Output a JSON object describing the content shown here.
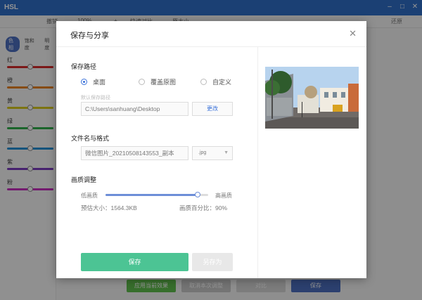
{
  "app": {
    "title": "HSL",
    "toolbar": [
      "撤销",
      "100%",
      "+",
      "快速对比",
      "原大小"
    ],
    "restore": "还原",
    "tabs": [
      "色相",
      "饱和度",
      "明度"
    ],
    "channels": [
      {
        "label": "红",
        "color": "#d62a2a"
      },
      {
        "label": "橙",
        "color": "#e8821c"
      },
      {
        "label": "黄",
        "color": "#d8c81c"
      },
      {
        "label": "绿",
        "color": "#2fae4b"
      },
      {
        "label": "蓝",
        "color": "#1f8fd6"
      },
      {
        "label": "紫",
        "color": "#7b3bbf"
      },
      {
        "label": "粉",
        "color": "#c92fbf"
      }
    ],
    "bottom_buttons": [
      {
        "label": "应用当前效果",
        "color": "#5fbd4d"
      },
      {
        "label": "取消本次调整",
        "color": "#c9c9c9"
      },
      {
        "label": "对比",
        "color": "#d6d6d6"
      },
      {
        "label": "保存",
        "color": "#4c6fc0"
      }
    ]
  },
  "dialog": {
    "title": "保存与分享",
    "save_path": {
      "heading": "保存路径",
      "options": [
        {
          "label": "桌面",
          "selected": true
        },
        {
          "label": "覆盖原图",
          "selected": false
        },
        {
          "label": "自定义",
          "selected": false
        }
      ],
      "default_hint": "默认保存路径",
      "path_value": "C:\\Users\\sanhuang\\Desktop",
      "change_label": "更改"
    },
    "file": {
      "heading": "文件名与格式",
      "filename": "微信图片_20210508143553_副本",
      "format": ".jpg"
    },
    "quality": {
      "heading": "画质调整",
      "low_label": "低画质",
      "high_label": "高画质",
      "level": 0.9,
      "estimated_size": "预估大小：1564.3KB",
      "percent_label": "画质百分比：90%"
    },
    "save_label": "保存",
    "save_as_label": "另存为"
  },
  "colors": {
    "accent_green": "#4cc494",
    "accent_blue": "#3b72d9",
    "titlebar": "#2f6fc9"
  }
}
